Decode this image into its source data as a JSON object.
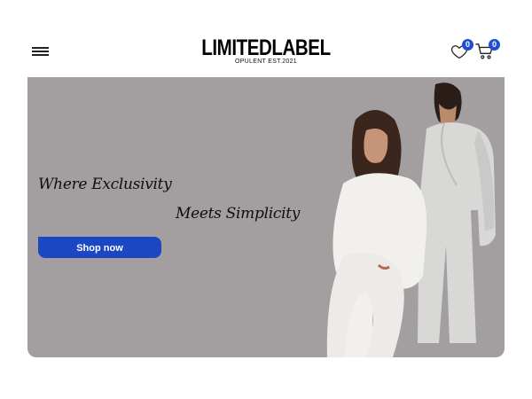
{
  "header": {
    "brand_name": "LIMITEDLABEL",
    "brand_tagline": "OPULENT EST.2021",
    "wishlist_count": "0",
    "cart_count": "0",
    "menu_icon": "hamburger-menu-icon",
    "wishlist_icon": "heart-icon",
    "cart_icon": "cart-icon"
  },
  "hero": {
    "headline_line1": "Where Exclusivity",
    "headline_line2": "Meets Simplicity",
    "cta_label": "Shop now",
    "background_color": "#a39fa0",
    "cta_color": "#1b46c4"
  },
  "colors": {
    "badge": "#1e4fd1",
    "text": "#000000"
  }
}
